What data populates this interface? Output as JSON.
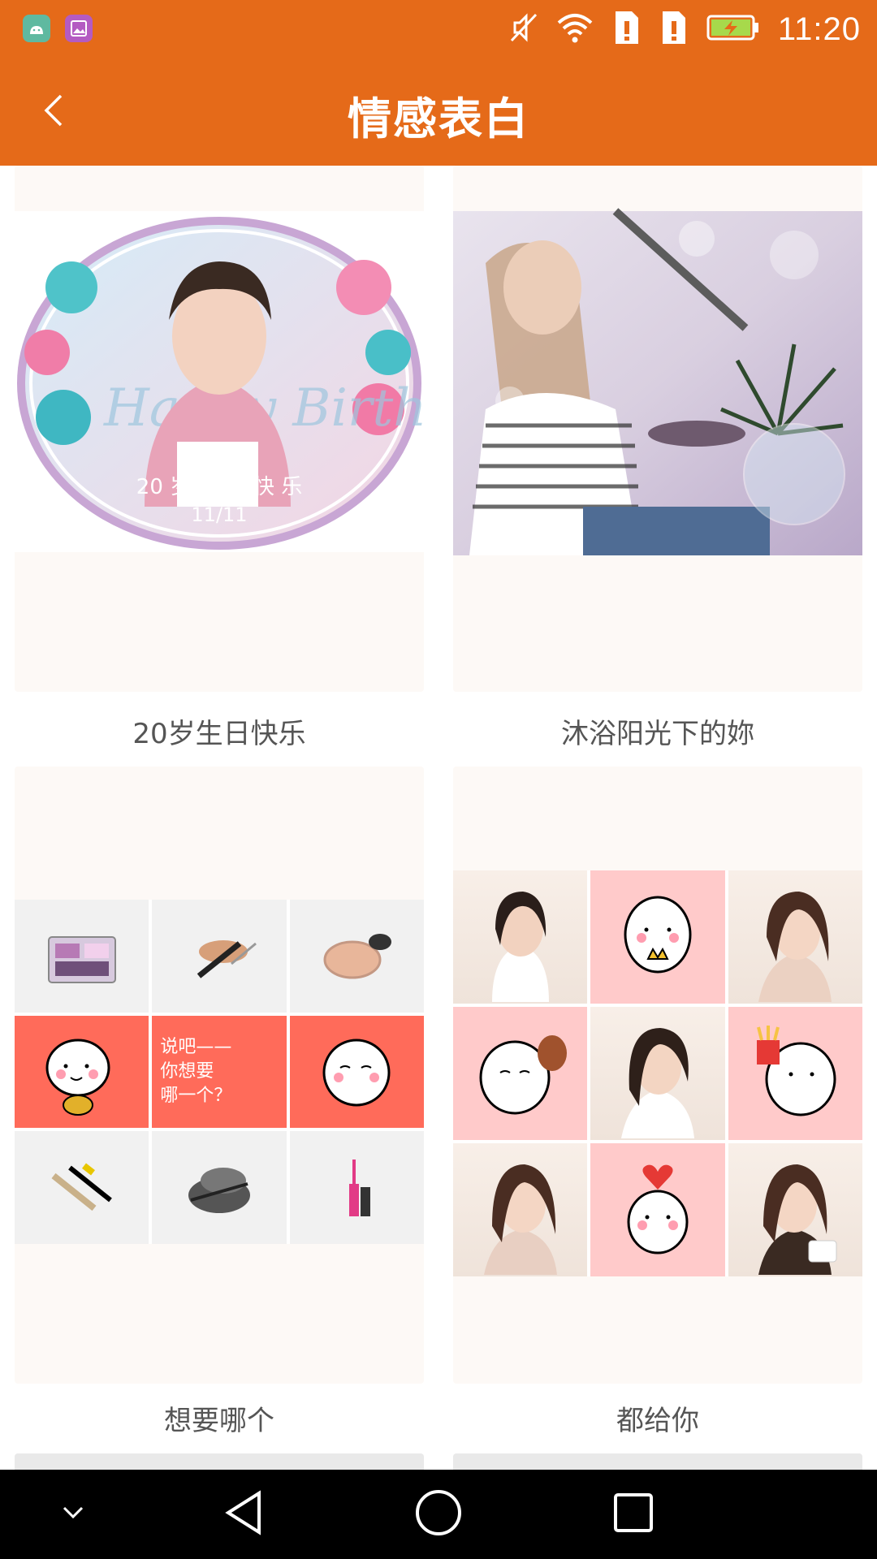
{
  "status_bar": {
    "time": "11:20",
    "icons": [
      "android-icon",
      "gallery-icon",
      "mute-icon",
      "wifi-icon",
      "sim1-alert-icon",
      "sim2-alert-icon",
      "battery-charging-icon"
    ]
  },
  "app_bar": {
    "title": "情感表白",
    "back_icon": "chevron-left-icon"
  },
  "colors": {
    "accent": "#E56A19",
    "card_bg": "#FDF9F6",
    "caption_text": "#555555",
    "coral": "#FF6B5A",
    "pink": "#FFCACA"
  },
  "cards": [
    {
      "caption": "20岁生日快乐",
      "image_text": {
        "line1": "20 岁 生 日 快 乐",
        "line2": "11/11",
        "script": "Happy Birthday"
      }
    },
    {
      "caption": "沐浴阳光下的妳"
    },
    {
      "caption": "想要哪个",
      "center_text": "说吧——\n你想要\n哪一个？"
    },
    {
      "caption": "都给你"
    }
  ],
  "nav_bar": {
    "icons": [
      "chevron-down-icon",
      "back-triangle-icon",
      "home-circle-icon",
      "recents-square-icon"
    ]
  }
}
